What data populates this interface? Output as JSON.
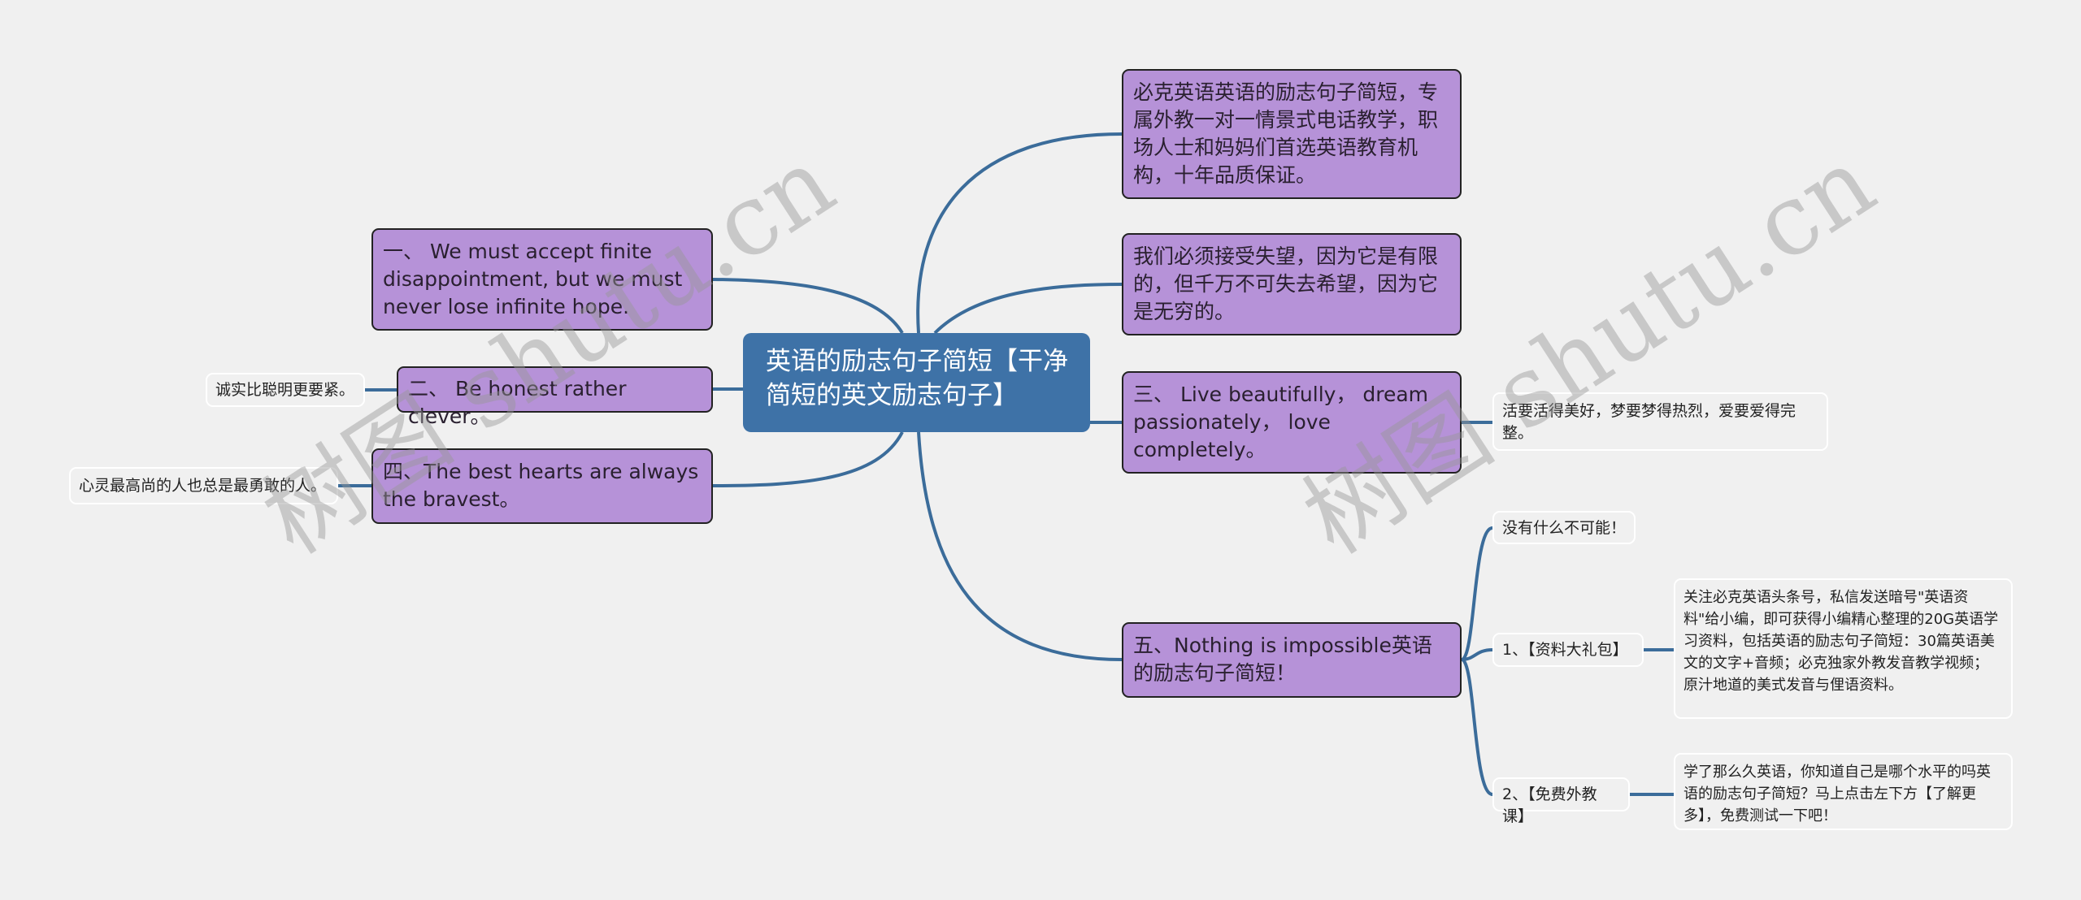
{
  "root": {
    "title": "英语的励志句子简短【干净简短的英文励志句子】"
  },
  "left_topics": [
    {
      "label": "一、 We must accept finite disappointment, but we must never lose infinite hope.",
      "children": []
    },
    {
      "label": "二、 Be honest rather clever。",
      "children": [
        "诚实比聪明更要紧。"
      ]
    },
    {
      "label": "四、The best hearts are always the bravest。",
      "children": [
        "心灵最高尚的人也总是最勇敢的人。"
      ]
    }
  ],
  "right_topics": [
    {
      "label": "必克英语英语的励志句子简短，专属外教一对一情景式电话教学，职场人士和妈妈们首选英语教育机构，十年品质保证。",
      "children": []
    },
    {
      "label": "我们必须接受失望，因为它是有限的，但千万不可失去希望，因为它是无穷的。",
      "children": []
    },
    {
      "label": "三、 Live beautifully， dream passionately， love completely。",
      "children": [
        "活要活得美好，梦要梦得热烈，爱要爱得完整。"
      ]
    },
    {
      "label": "五、Nothing is impossible英语的励志句子简短！",
      "children": [
        {
          "label": "没有什么不可能！"
        },
        {
          "label": "1、【资料大礼包】",
          "detail": "关注必克英语头条号，私信发送暗号\"英语资料\"给小编，即可获得小编精心整理的20G英语学习资料，包括英语的励志句子简短：30篇英语美文的文字+音频；必克独家外教发音教学视频； 原汁地道的美式发音与俚语资料。"
        },
        {
          "label": "2、【免费外教课】",
          "detail": "学了那么久英语，你知道自己是哪个水平的吗英语的励志句子简短？马上点击左下方【了解更多】，免费测试一下吧！"
        }
      ]
    }
  ],
  "watermarks": [
    "树图 shutu.cn",
    "树图 shutu.cn"
  ],
  "colors": {
    "root": "#3e72a7",
    "topic": "#b692d8",
    "link": "#3b6c9a",
    "background": "#f0f0f0"
  }
}
